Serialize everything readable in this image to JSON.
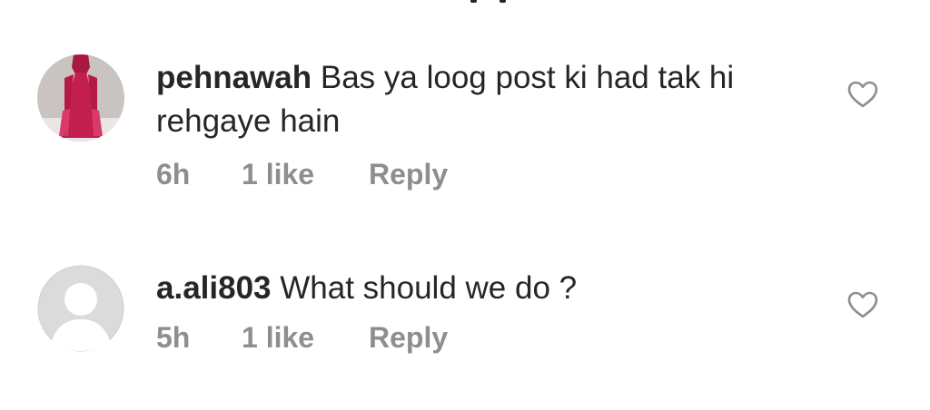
{
  "comments": [
    {
      "username": "pehnawah",
      "text": "Bas ya loog post ki had tak hi rehgaye hain",
      "time": "6h",
      "likes": "1 like",
      "reply_label": "Reply",
      "avatar_icon": "profile-photo"
    },
    {
      "username": "a.ali803",
      "text": "What should we do ?",
      "time": "5h",
      "likes": "1 like",
      "reply_label": "Reply",
      "avatar_icon": "default-avatar"
    }
  ],
  "icons": {
    "like": "heart-outline-icon"
  },
  "colors": {
    "primary_text": "#262626",
    "secondary_text": "#8e8e8e",
    "icon_stroke": "#8e8e8e",
    "default_avatar_bg": "#dbdbdb",
    "default_avatar_fg": "#ffffff",
    "profile_dress": "#c21f4f"
  }
}
